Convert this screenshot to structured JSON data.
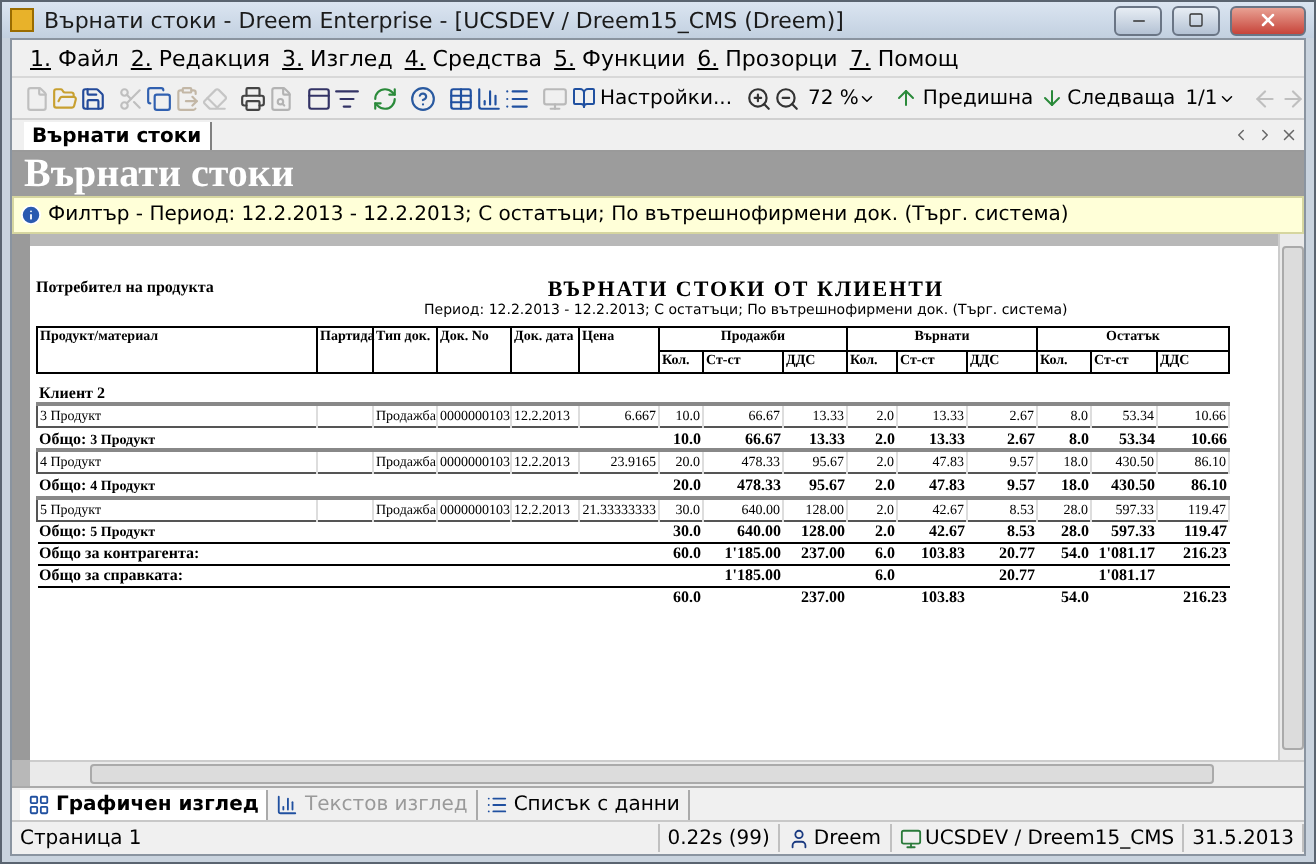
{
  "window": {
    "title": "Върнати стоки - Dreem Enterprise - [UCSDEV / Dreem15_CMS (Dreem)]"
  },
  "menu": [
    "1. Файл",
    "2. Редакция",
    "3. Изглед",
    "4. Средства",
    "5. Функции",
    "6. Прозорци",
    "7. Помощ"
  ],
  "toolbar": {
    "tools": [
      {
        "kind": "icon",
        "disabled": true
      },
      {
        "kind": "icon",
        "disabled": false
      },
      {
        "kind": "icon",
        "disabled": false
      },
      {
        "kind": "separator"
      },
      {
        "kind": "icon",
        "disabled": true
      },
      {
        "kind": "icon",
        "disabled": false
      },
      {
        "kind": "icon",
        "disabled": true
      },
      {
        "kind": "icon",
        "disabled": true
      },
      {
        "kind": "separator"
      },
      {
        "kind": "icon",
        "disabled": false
      },
      {
        "kind": "icon",
        "disabled": true
      },
      {
        "kind": "separator"
      },
      {
        "kind": "icon",
        "disabled": false
      },
      {
        "kind": "icon",
        "disabled": false
      },
      {
        "kind": "separator"
      },
      {
        "kind": "icon",
        "disabled": false
      },
      {
        "kind": "separator"
      },
      {
        "kind": "icon",
        "disabled": false
      },
      {
        "kind": "separator"
      },
      {
        "kind": "icon",
        "disabled": false
      },
      {
        "kind": "icon",
        "disabled": false
      },
      {
        "kind": "icon",
        "disabled": false
      },
      {
        "kind": "separator"
      },
      {
        "kind": "icon",
        "disabled": true
      },
      {
        "kind": "button",
        "label": "Настройки..."
      },
      {
        "kind": "separator"
      },
      {
        "kind": "icon",
        "disabled": false
      },
      {
        "kind": "icon",
        "disabled": false
      },
      {
        "kind": "combo",
        "value": "72 %"
      },
      {
        "kind": "separator"
      },
      {
        "kind": "button",
        "label": "Предишна"
      },
      {
        "kind": "button",
        "label": "Следваща"
      },
      {
        "kind": "combo",
        "value": "1/1"
      },
      {
        "kind": "separator"
      },
      {
        "kind": "icon",
        "disabled": true
      },
      {
        "kind": "icon",
        "disabled": true
      }
    ]
  },
  "doc_tabs": [
    {
      "label": "Върнати стоки",
      "selected": true
    }
  ],
  "header": {
    "title": "Върнати стоки"
  },
  "filter": {
    "text": "Филтър - Период: 12.2.2013 - 12.2.2013; С остатъци; По вътрешнофирмени док. (Търг. система)"
  },
  "report": {
    "owner": "Потребител на продукта",
    "title": "ВЪРНАТИ СТОКИ ОТ КЛИЕНТИ",
    "subtitle": "Период: 12.2.2013 - 12.2.2013; С остатъци; По вътрешнофирмени док. (Търг. система)",
    "columns": [
      {
        "label": "Продукт/материал"
      },
      {
        "label": "Партида"
      },
      {
        "label": "Тип док."
      },
      {
        "label": "Док. No"
      },
      {
        "label": "Док. дата"
      },
      {
        "label": "Цена"
      },
      {
        "label": "Продажби",
        "children": [
          "Кол.",
          "Ст-ст",
          "ДДС"
        ]
      },
      {
        "label": "Върнати",
        "children": [
          "Кол.",
          "Ст-ст",
          "ДДС"
        ]
      },
      {
        "label": "Остатък",
        "children": [
          "Кол.",
          "Ст-ст",
          "ДДС"
        ]
      }
    ],
    "rows": [
      {
        "kind": "group",
        "label": "Клиент 2"
      },
      {
        "kind": "detail",
        "product": "3 Продукт",
        "doc_type": "Продажба",
        "doc_no": "0000000103",
        "doc_date": "12.2.2013",
        "price": "6.667",
        "values": [
          "10.0",
          "66.67",
          "13.33",
          "2.0",
          "13.33",
          "2.67",
          "8.0",
          "53.34",
          "10.66"
        ]
      },
      {
        "kind": "total",
        "label": "Общо:",
        "product": "3 Продукт",
        "values": [
          "10.0",
          "66.67",
          "13.33",
          "2.0",
          "13.33",
          "2.67",
          "8.0",
          "53.34",
          "10.66"
        ]
      },
      {
        "kind": "detail",
        "product": "4 Продукт",
        "doc_type": "Продажба",
        "doc_no": "0000000103",
        "doc_date": "12.2.2013",
        "price": "23.9165",
        "values": [
          "20.0",
          "478.33",
          "95.67",
          "2.0",
          "47.83",
          "9.57",
          "18.0",
          "430.50",
          "86.10"
        ]
      },
      {
        "kind": "total",
        "label": "Общо:",
        "product": "4 Продукт",
        "values": [
          "20.0",
          "478.33",
          "95.67",
          "2.0",
          "47.83",
          "9.57",
          "18.0",
          "430.50",
          "86.10"
        ]
      },
      {
        "kind": "detail",
        "product": "5 Продукт",
        "doc_type": "Продажба",
        "doc_no": "0000000103",
        "doc_date": "12.2.2013",
        "price": "21.33333333",
        "values": [
          "30.0",
          "640.00",
          "128.00",
          "2.0",
          "42.67",
          "8.53",
          "28.0",
          "597.33",
          "119.47"
        ]
      },
      {
        "kind": "total",
        "label": "Общо:",
        "product": "5 Продукт",
        "values": [
          "30.0",
          "640.00",
          "128.00",
          "2.0",
          "42.67",
          "8.53",
          "28.0",
          "597.33",
          "119.47"
        ]
      },
      {
        "kind": "client_total",
        "label": "Общо за контрагента:",
        "values": [
          "60.0",
          "1'185.00",
          "237.00",
          "6.0",
          "103.83",
          "20.77",
          "54.0",
          "1'081.17",
          "216.23"
        ]
      },
      {
        "kind": "report_total",
        "label": "Общо за справката:",
        "slots": {
          "sales_value": "1'185.00",
          "returned_qty": "6.0",
          "returned_vat": "20.77",
          "balance_value": "1'081.17"
        }
      },
      {
        "kind": "report_total",
        "slots": {
          "sales_qty": "60.0",
          "sales_vat": "237.00",
          "returned_value": "103.83",
          "balance_qty": "54.0",
          "balance_vat": "216.23"
        }
      }
    ]
  },
  "bottom_tabs": [
    {
      "label": "Графичен изглед",
      "selected": true,
      "disabled": false
    },
    {
      "label": "Текстов изглед",
      "selected": false,
      "disabled": true
    },
    {
      "label": "Списък с данни",
      "selected": false,
      "disabled": false
    }
  ],
  "status_bar": {
    "page": "Страница 1",
    "timing": "0.22s (99)",
    "user": "Dreem",
    "connection": "UCSDEV / Dreem15_CMS",
    "date": "31.5.2013"
  }
}
